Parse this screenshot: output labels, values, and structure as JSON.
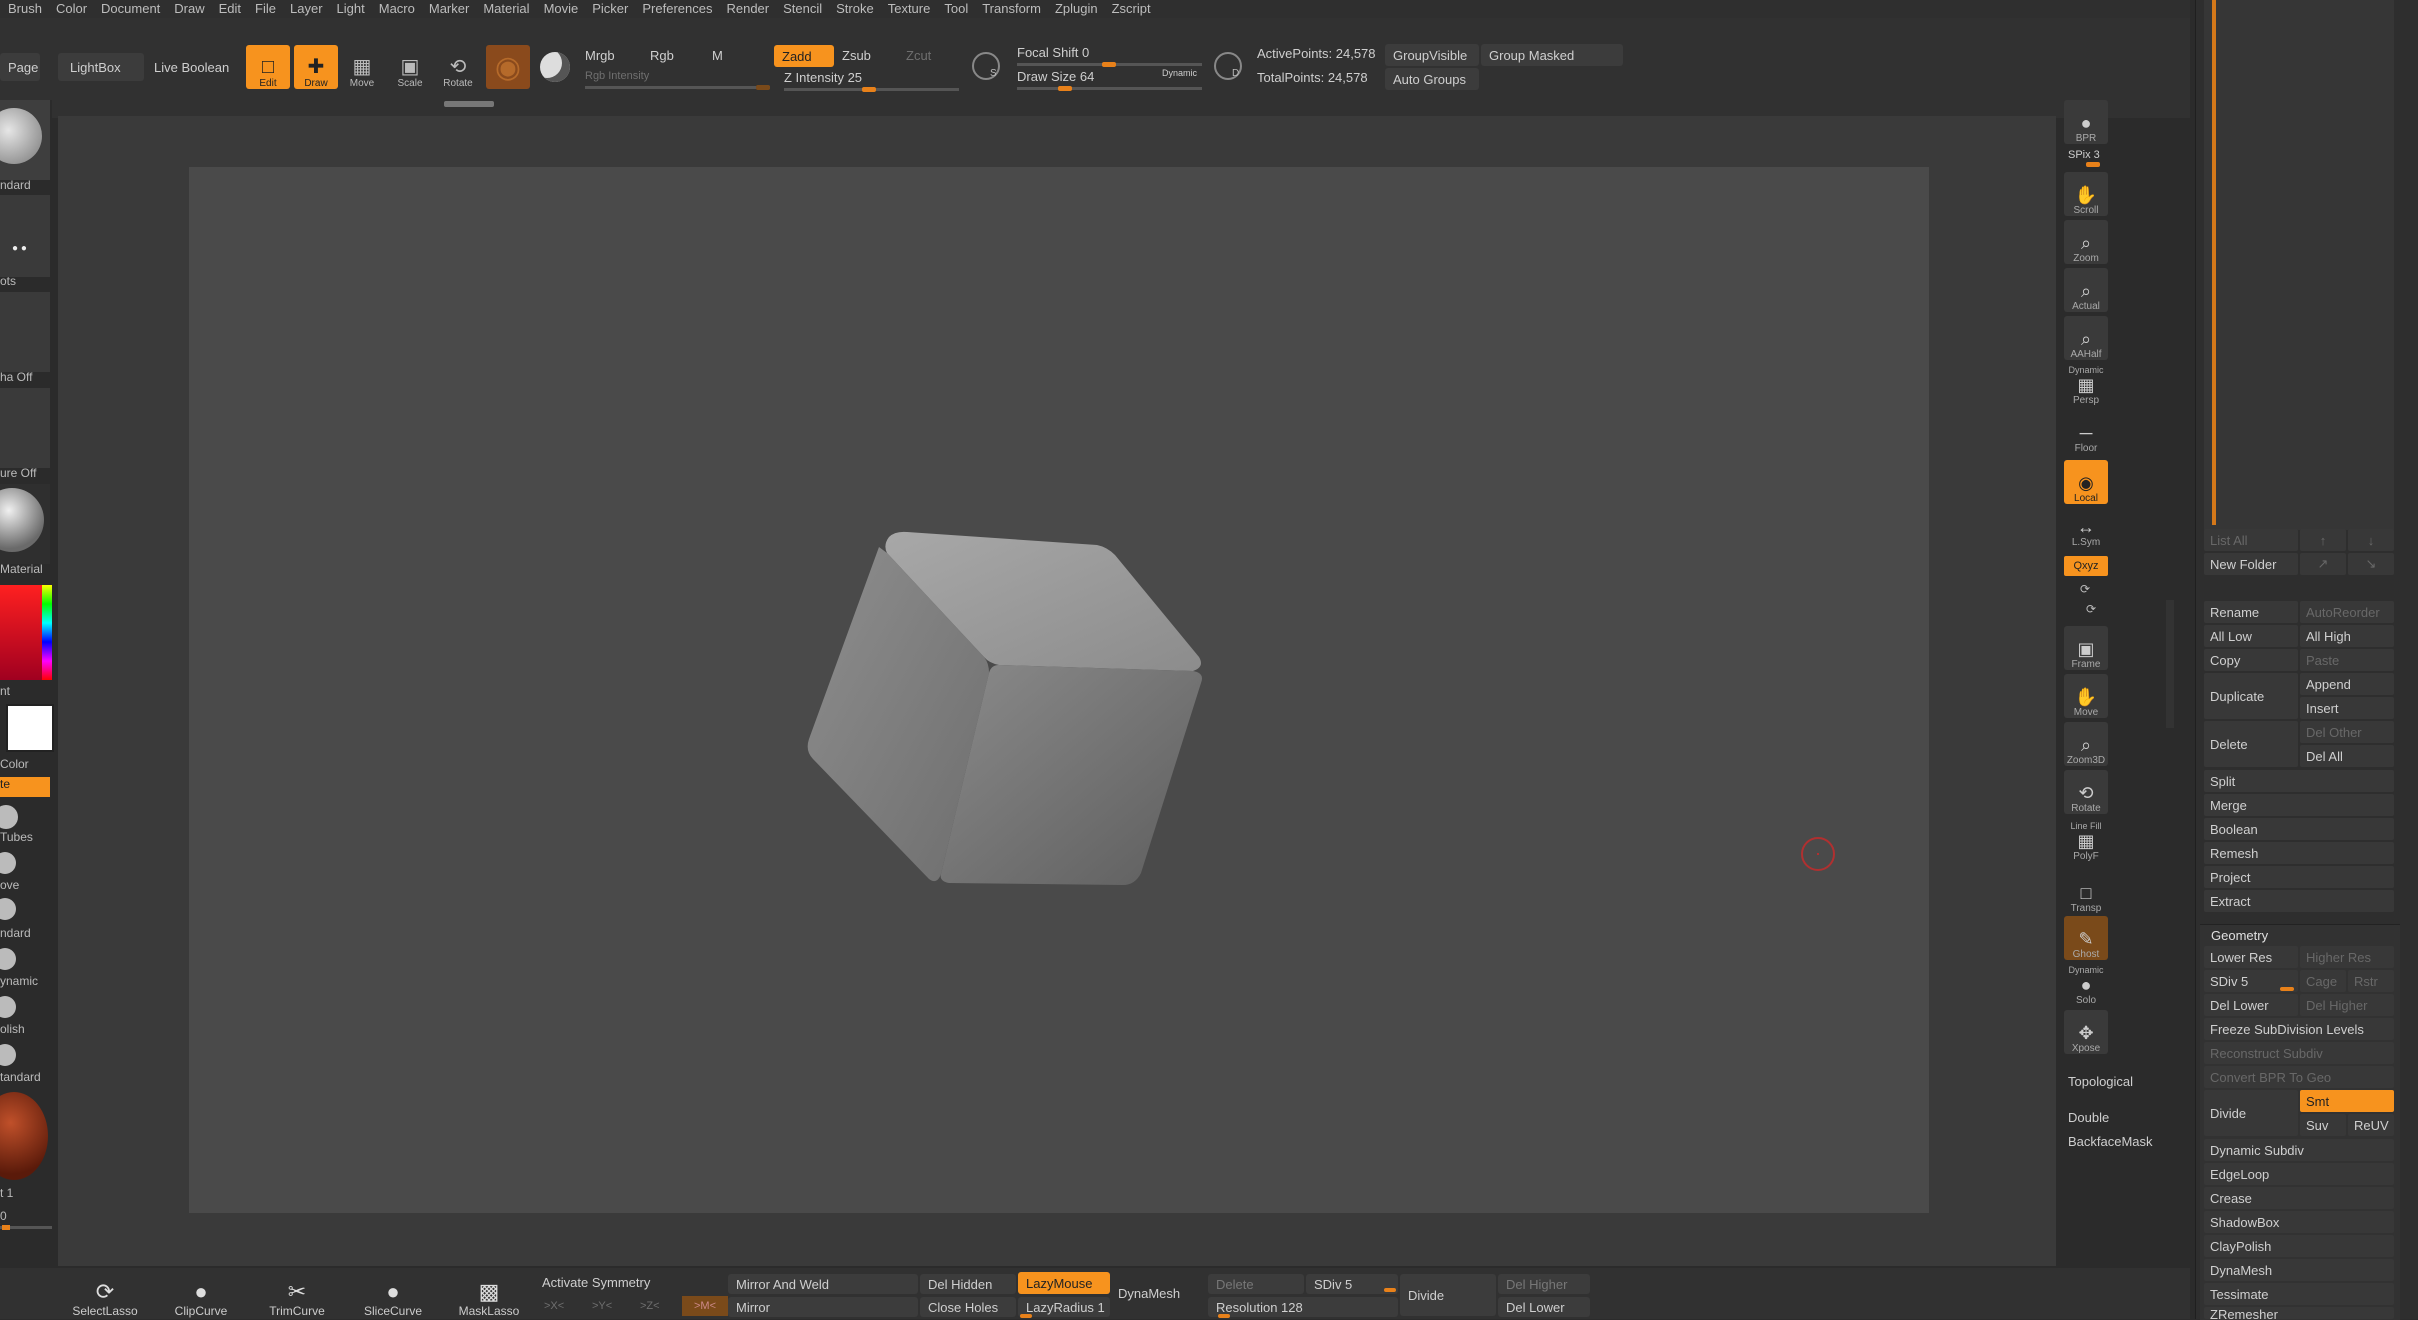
{
  "menu": [
    "Brush",
    "Color",
    "Document",
    "Draw",
    "Edit",
    "File",
    "Layer",
    "Light",
    "Macro",
    "Marker",
    "Material",
    "Movie",
    "Picker",
    "Preferences",
    "Render",
    "Stencil",
    "Stroke",
    "Texture",
    "Tool",
    "Transform",
    "Zplugin",
    "Zscript"
  ],
  "top": {
    "page": "Page",
    "lightbox": "LightBox",
    "live_boolean": "Live Boolean",
    "edit": "Edit",
    "draw": "Draw",
    "move": "Move",
    "scale": "Scale",
    "rotate": "Rotate",
    "mrgb": "Mrgb",
    "rgb": "Rgb",
    "m": "M",
    "rgb_intensity": "Rgb Intensity",
    "zadd": "Zadd",
    "zsub": "Zsub",
    "zcut": "Zcut",
    "z_intensity": "Z Intensity 25",
    "focal_shift": "Focal Shift 0",
    "draw_size": "Draw Size 64",
    "dynamic": "Dynamic",
    "active_points": "ActivePoints: 24,578",
    "total_points": "TotalPoints: 24,578",
    "group_visible": "GroupVisible",
    "group_masked": "Group Masked",
    "auto_groups": "Auto Groups",
    "s_key": "S",
    "d_key": "D"
  },
  "left": {
    "standard": "ndard",
    "dots": "ots",
    "alpha_off": "ha Off",
    "texture_off": "ure Off",
    "material": "Material",
    "gradient": "nt",
    "color": "Color",
    "switch": "te",
    "tubes": "Tubes",
    "move": "ove",
    "standard2": "ndard",
    "dynamic": "ynamic",
    "polish": "olish",
    "standard3": "tandard",
    "label1": "t 1",
    "zero": "0"
  },
  "right_toolbar": {
    "bpr": "BPR",
    "spix": "SPix 3",
    "scroll": "Scroll",
    "zoom": "Zoom",
    "actual": "Actual",
    "aahalf": "AAHalf",
    "dynamic_persp": "Dynamic",
    "persp": "Persp",
    "floor": "Floor",
    "local": "Local",
    "lsym": "L.Sym",
    "xyz": "Qxyz",
    "frame": "Frame",
    "move": "Move",
    "zoom3d": "Zoom3D",
    "rotate": "Rotate",
    "line_fill": "Line Fill",
    "polyf": "PolyF",
    "transp": "Transp",
    "ghost": "Ghost",
    "dynamic_solo": "Dynamic",
    "solo": "Solo",
    "xpose": "Xpose",
    "topological": "Topological",
    "double": "Double",
    "backfacemask": "BackfaceMask"
  },
  "subtool": {
    "list_all": "List All",
    "new_folder": "New Folder",
    "rename": "Rename",
    "auto_reorder": "AutoReorder",
    "all_low": "All Low",
    "all_high": "All High",
    "copy": "Copy",
    "paste": "Paste",
    "duplicate": "Duplicate",
    "append": "Append",
    "insert": "Insert",
    "delete": "Delete",
    "del_other": "Del Other",
    "del_all": "Del All",
    "split": "Split",
    "merge": "Merge",
    "boolean": "Boolean",
    "remesh": "Remesh",
    "project": "Project",
    "extract": "Extract"
  },
  "geometry": {
    "title": "Geometry",
    "lower_res": "Lower Res",
    "higher_res": "Higher Res",
    "sdiv": "SDiv 5",
    "cage": "Cage",
    "rstr": "Rstr",
    "del_lower": "Del Lower",
    "del_higher": "Del Higher",
    "freeze": "Freeze SubDivision Levels",
    "reconstruct": "Reconstruct Subdiv",
    "convert_bpr": "Convert BPR To Geo",
    "divide": "Divide",
    "smt": "Smt",
    "suv": "Suv",
    "reuv": "ReUV",
    "dynamic_subdiv": "Dynamic Subdiv",
    "edgeloop": "EdgeLoop",
    "crease": "Crease",
    "shadowbox": "ShadowBox",
    "claypolish": "ClayPolish",
    "dynamesh": "DynaMesh",
    "tessimate": "Tessimate",
    "zremesher": "ZRemesher"
  },
  "bottom": {
    "selectlasso": "SelectLasso",
    "clipcurve": "ClipCurve",
    "trimcurve": "TrimCurve",
    "slicecurve": "SliceCurve",
    "masklasso": "MaskLasso",
    "activate_symmetry": "Activate Symmetry",
    "x": ">X<",
    "y": ">Y<",
    "z": ">Z<",
    "m": ">M<",
    "mirror_and_weld": "Mirror And Weld",
    "mirror": "Mirror",
    "del_hidden": "Del Hidden",
    "close_holes": "Close Holes",
    "lazymouse": "LazyMouse",
    "lazyradius": "LazyRadius 1",
    "dynamesh": "DynaMesh",
    "delete": "Delete",
    "resolution": "Resolution 128",
    "sdiv": "SDiv 5",
    "divide": "Divide",
    "del_higher": "Del Higher",
    "del_lower": "Del Lower"
  },
  "colors": {
    "accent": "#f7931e",
    "background": "#2b2b2b",
    "document": "#4a4a4a"
  }
}
